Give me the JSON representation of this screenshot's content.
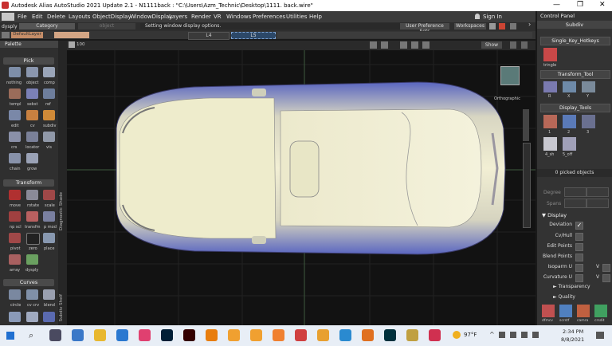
{
  "title_bar": {
    "title": "Autodesk Alias AutoStudio 2021 Update 2.1    - N1111back : \"C:\\Users\\Azm_Technic\\Desktop\\1111. back.wire\""
  },
  "menu": {
    "items": [
      "File",
      "Edit",
      "Delete",
      "Layouts",
      "ObjectDisplay",
      "WindowDisplay",
      "Layers",
      "Render",
      "VR",
      "Windows",
      "Preferences",
      "Utilities",
      "Help"
    ],
    "sign_in": "Sign In"
  },
  "toolbar": {
    "dysply": "dysply",
    "category": "Category",
    "object": "object",
    "status": "Setting window display options.",
    "user_pref": "User Preference Sets",
    "workspaces": "Workspaces",
    "def_layer": "DefaultLayer",
    "l4": "L4",
    "l5": "L5"
  },
  "palette": {
    "title": "Palette",
    "sections": [
      {
        "header": "Pick",
        "items": [
          "nothing",
          "object",
          "comp",
          "templ",
          "sebst",
          "ref",
          "edit",
          "cv",
          "subdiv",
          "crs",
          "locator",
          "vis",
          "chain",
          "grow"
        ]
      },
      {
        "header": "Transform",
        "items": [
          "move",
          "rotate",
          "scale",
          "np scl",
          "transfm",
          "p mod",
          "pivot",
          "zero",
          "place",
          "array",
          "dysply"
        ]
      },
      {
        "header": "Curves",
        "items": [
          "circle",
          "cv crv",
          "blend"
        ]
      }
    ],
    "side_labels": [
      "Diagnostic Shade",
      "Subdiv Shelf"
    ]
  },
  "viewport": {
    "label": "Orthographic",
    "show_btn": "Show",
    "zoom": "100"
  },
  "right_panel": {
    "control_panel": "Control Panel",
    "subdiv": "Subdiv",
    "hotkeys": "Single_Key_Hotkeys",
    "triangle": "tringle",
    "transform_tool": "Transform_Tool",
    "transform_labels": [
      "R",
      "X",
      "Y"
    ],
    "display_tools": "Display_Tools",
    "display_labels": [
      "1",
      "2",
      "3",
      "4_sh",
      "5_off"
    ],
    "picked": "0 picked objects",
    "degree": "Degree",
    "spans": "Spans",
    "display_section": "Display",
    "rows": [
      {
        "label": "Deviation",
        "checked": true
      },
      {
        "label": "Cv/Hull",
        "checked": false
      },
      {
        "label": "Edit Points",
        "checked": false
      },
      {
        "label": "Blend Points",
        "checked": false
      },
      {
        "label": "Isoparm U",
        "checked": false,
        "v": "V"
      },
      {
        "label": "Curvature U",
        "checked": false,
        "v": "V"
      }
    ],
    "transparency": "Transparency",
    "quality": "Quality",
    "bottom_icons": [
      "dfmcv",
      "scrstf",
      "camra",
      "crsdit"
    ]
  },
  "taskbar": {
    "time": "2:34 PM",
    "date": "8/8/2021",
    "temp": "97°F"
  },
  "colors": {
    "accent": "#4a74b8",
    "car_body": "#e8e4c4",
    "car_side": "#6d78c4"
  }
}
